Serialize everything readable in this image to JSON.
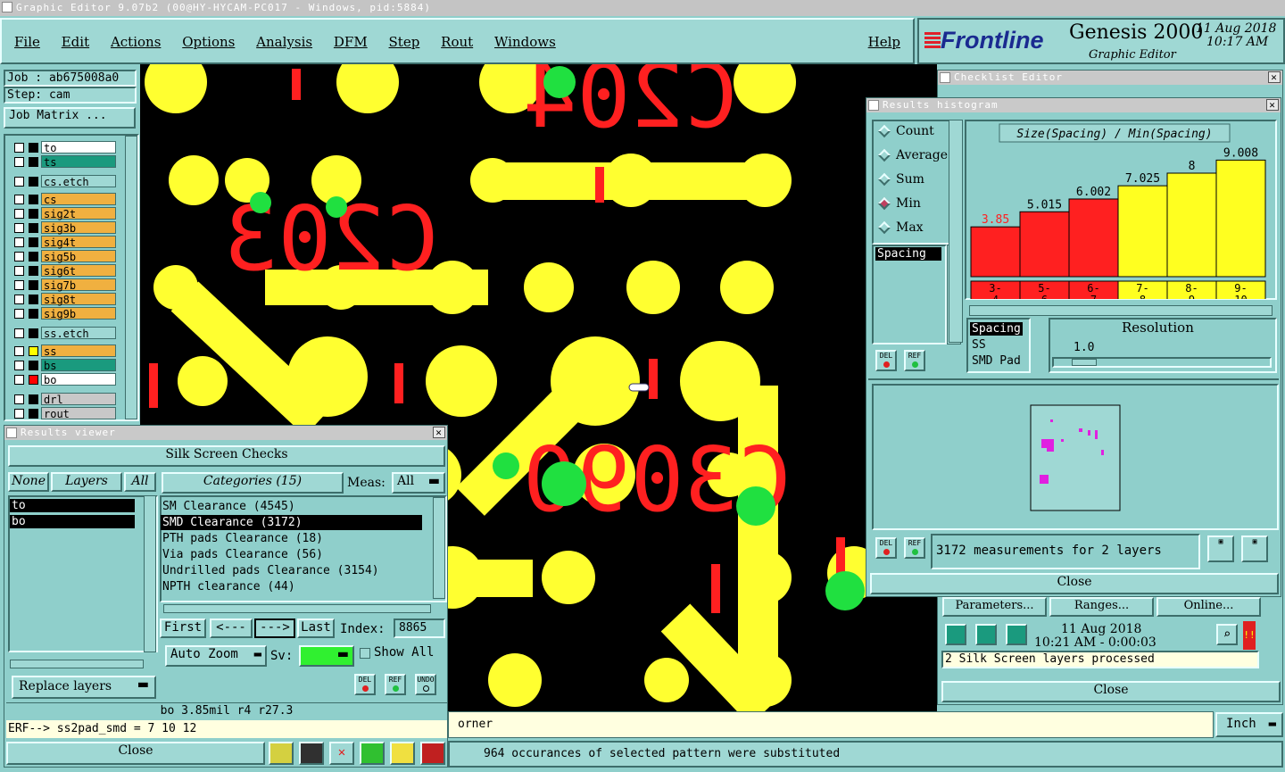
{
  "window": {
    "title": "Graphic Editor 9.07b2 (00@HY-HYCAM-PC017 - Windows, pid:5884)"
  },
  "menu": [
    "File",
    "Edit",
    "Actions",
    "Options",
    "Analysis",
    "DFM",
    "Step",
    "Rout",
    "Windows"
  ],
  "help": "Help",
  "brand": {
    "logo": "Frontline",
    "product": "Genesis 2000",
    "subtitle": "Graphic Editor",
    "date": "11 Aug 2018",
    "time": "10:17 AM"
  },
  "job": {
    "job_label": "Job : ab675008a0",
    "step_label": "Step: cam",
    "matrix_button": "Job Matrix ..."
  },
  "layers": [
    {
      "name": "to",
      "color": "#ffffff",
      "dot": ""
    },
    {
      "name": "ts",
      "color": "#1a9a7e",
      "dot": ""
    },
    {
      "name": "cs.etch",
      "color": "#9fd8d4",
      "dot": ""
    },
    {
      "name": "cs",
      "color": "#f0b040",
      "dot": ""
    },
    {
      "name": "sig2t",
      "color": "#f0b040",
      "dot": ""
    },
    {
      "name": "sig3b",
      "color": "#f0b040",
      "dot": ""
    },
    {
      "name": "sig4t",
      "color": "#f0b040",
      "dot": ""
    },
    {
      "name": "sig5b",
      "color": "#f0b040",
      "dot": ""
    },
    {
      "name": "sig6t",
      "color": "#f0b040",
      "dot": ""
    },
    {
      "name": "sig7b",
      "color": "#f0b040",
      "dot": ""
    },
    {
      "name": "sig8t",
      "color": "#f0b040",
      "dot": ""
    },
    {
      "name": "sig9b",
      "color": "#f0b040",
      "dot": ""
    },
    {
      "name": "ss.etch",
      "color": "#9fd8d4",
      "dot": ""
    },
    {
      "name": "ss",
      "color": "#f0b040",
      "dot": "#ffff00"
    },
    {
      "name": "bs",
      "color": "#1a9a7e",
      "dot": ""
    },
    {
      "name": "bo",
      "color": "#ffffff",
      "dot": "#ff0000"
    },
    {
      "name": "drl",
      "color": "#c8c8c8",
      "dot": ""
    },
    {
      "name": "rout",
      "color": "#c8c8c8",
      "dot": ""
    }
  ],
  "canvas_text": [
    "C203",
    "C3090",
    "C204"
  ],
  "results_viewer": {
    "title": "Results viewer",
    "header": "Silk Screen Checks",
    "none_btn": "None",
    "layers_tab": "Layers",
    "all_btn": "All",
    "layers": [
      "to",
      "bo"
    ],
    "categories_tab": "Categories (15)",
    "meas_label": "Meas:",
    "meas_value": "All",
    "categories": [
      "SM Clearance (4545)",
      "SMD Clearance (3172)",
      "PTH pads Clearance (18)",
      "Via pads Clearance (56)",
      "Undrilled pads Clearance (3154)",
      "NPTH clearance (44)"
    ],
    "first": "First",
    "prev": "<---",
    "next": "--->",
    "last": "Last",
    "index_label": "Index:",
    "index_value": "8865",
    "auto_zoom": "Auto Zoom",
    "sv_label": "Sv:",
    "show_all": "Show All",
    "replace_layers": "Replace layers",
    "status": "bo 3.85mil  r4  r27.3",
    "erf": "ERF--> ss2pad_smd = 7 10 12",
    "close": "Close",
    "del": "DEL",
    "ref": "REF",
    "undo": "UNDO"
  },
  "checklist": {
    "title": "Checklist Editor",
    "params": "Parameters...",
    "ranges": "Ranges...",
    "online": "Online...",
    "date": "11 Aug 2018",
    "time": "10:21 AM - 0:00:03",
    "message": "2 Silk Screen layers processed",
    "close": "Close"
  },
  "histogram": {
    "title": "Results histogram",
    "modes": [
      "Count",
      "Average",
      "Sum",
      "Min",
      "Max"
    ],
    "selected_mode": "Min",
    "left_list": [
      "Spacing"
    ],
    "chart_title": "Size(Spacing) / Min(Spacing)",
    "resolution_list": [
      "Spacing",
      "SS",
      "SMD Pad"
    ],
    "resolution_label": "Resolution",
    "resolution_value": "1.0",
    "summary": "3172 measurements for 2 layers",
    "close": "Close",
    "del": "DEL",
    "ref": "REF"
  },
  "chart_data": {
    "type": "bar",
    "title": "Size(Spacing) / Min(Spacing)",
    "categories": [
      "3-4",
      "5-6",
      "6-7",
      "7-8",
      "8-9",
      "9-10"
    ],
    "values": [
      3.85,
      5.015,
      6.002,
      7.025,
      8,
      9.008
    ],
    "value_labels": [
      "3.85",
      "5.015",
      "6.002",
      "7.025",
      "8",
      "9.008"
    ],
    "bar_colors": [
      "#ff2020",
      "#ff2020",
      "#ff2020",
      "#ffff20",
      "#ffff20",
      "#ffff20"
    ],
    "label_colors": [
      "#ff2020",
      "#000000",
      "#000000",
      "#000000",
      "#000000",
      "#000000"
    ],
    "ylim": [
      0,
      10
    ]
  },
  "bottom": {
    "corner_text": "orner",
    "status": "964 occurances of selected pattern were substituted",
    "units": "Inch"
  }
}
